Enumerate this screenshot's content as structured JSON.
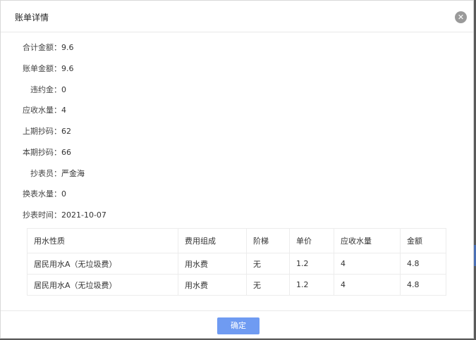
{
  "dialog": {
    "title": "账单详情",
    "close_icon": "close-icon"
  },
  "fields": [
    {
      "label": "合计金额：",
      "value": "9.6"
    },
    {
      "label": "账单金额：",
      "value": "9.6"
    },
    {
      "label": "违约金：",
      "value": "0"
    },
    {
      "label": "应收水量：",
      "value": "4"
    },
    {
      "label": "上期抄码：",
      "value": "62"
    },
    {
      "label": "本期抄码：",
      "value": "66"
    },
    {
      "label": "抄表员：",
      "value": "严金海"
    },
    {
      "label": "换表水量：",
      "value": "0"
    },
    {
      "label": "抄表时间：",
      "value": "2021-10-07"
    }
  ],
  "table": {
    "headers": [
      "用水性质",
      "费用组成",
      "阶梯",
      "单价",
      "应收水量",
      "金额"
    ],
    "rows": [
      [
        "居民用水A（无垃圾费）",
        "用水费",
        "无",
        "1.2",
        "4",
        "4.8"
      ],
      [
        "居民用水A（无垃圾费）",
        "用水费",
        "无",
        "1.2",
        "4",
        "4.8"
      ]
    ]
  },
  "footer": {
    "ok_label": "确定"
  },
  "colors": {
    "primary_button": "#6f9bf2",
    "close_button": "#9a9a9a"
  }
}
